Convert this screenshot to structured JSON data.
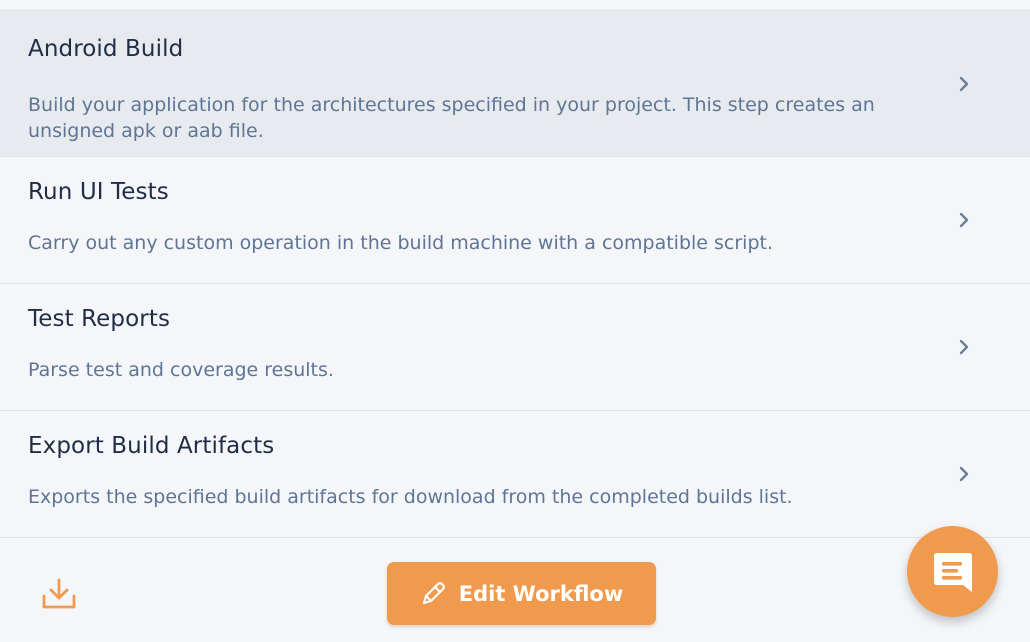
{
  "steps": [
    {
      "title": "Android Build",
      "description": "Build your application for the architectures specified in your project. This step creates an unsigned apk or aab file.",
      "selected": true,
      "icon": "chevron-right-icon"
    },
    {
      "title": "Run UI Tests",
      "description": "Carry out any custom operation in the build machine with a compatible script.",
      "selected": false,
      "icon": "chevron-right-icon"
    },
    {
      "title": "Test Reports",
      "description": "Parse test and coverage results.",
      "selected": false,
      "icon": "chevron-right-icon"
    },
    {
      "title": "Export Build Artifacts",
      "description": "Exports the specified build artifacts for download from the completed builds list.",
      "selected": false,
      "icon": "chevron-right-icon"
    }
  ],
  "footer": {
    "download_icon": "download-icon",
    "edit_button_label": "Edit Workflow",
    "edit_button_icon": "pencil-icon",
    "chat_icon": "chat-icon"
  },
  "colors": {
    "accent": "#ef9a4c",
    "title": "#1f2d45",
    "description": "#5f7595",
    "selected_row": "#e7ebef",
    "row": "#f4f6f9",
    "divider": "#dfe3e8"
  }
}
